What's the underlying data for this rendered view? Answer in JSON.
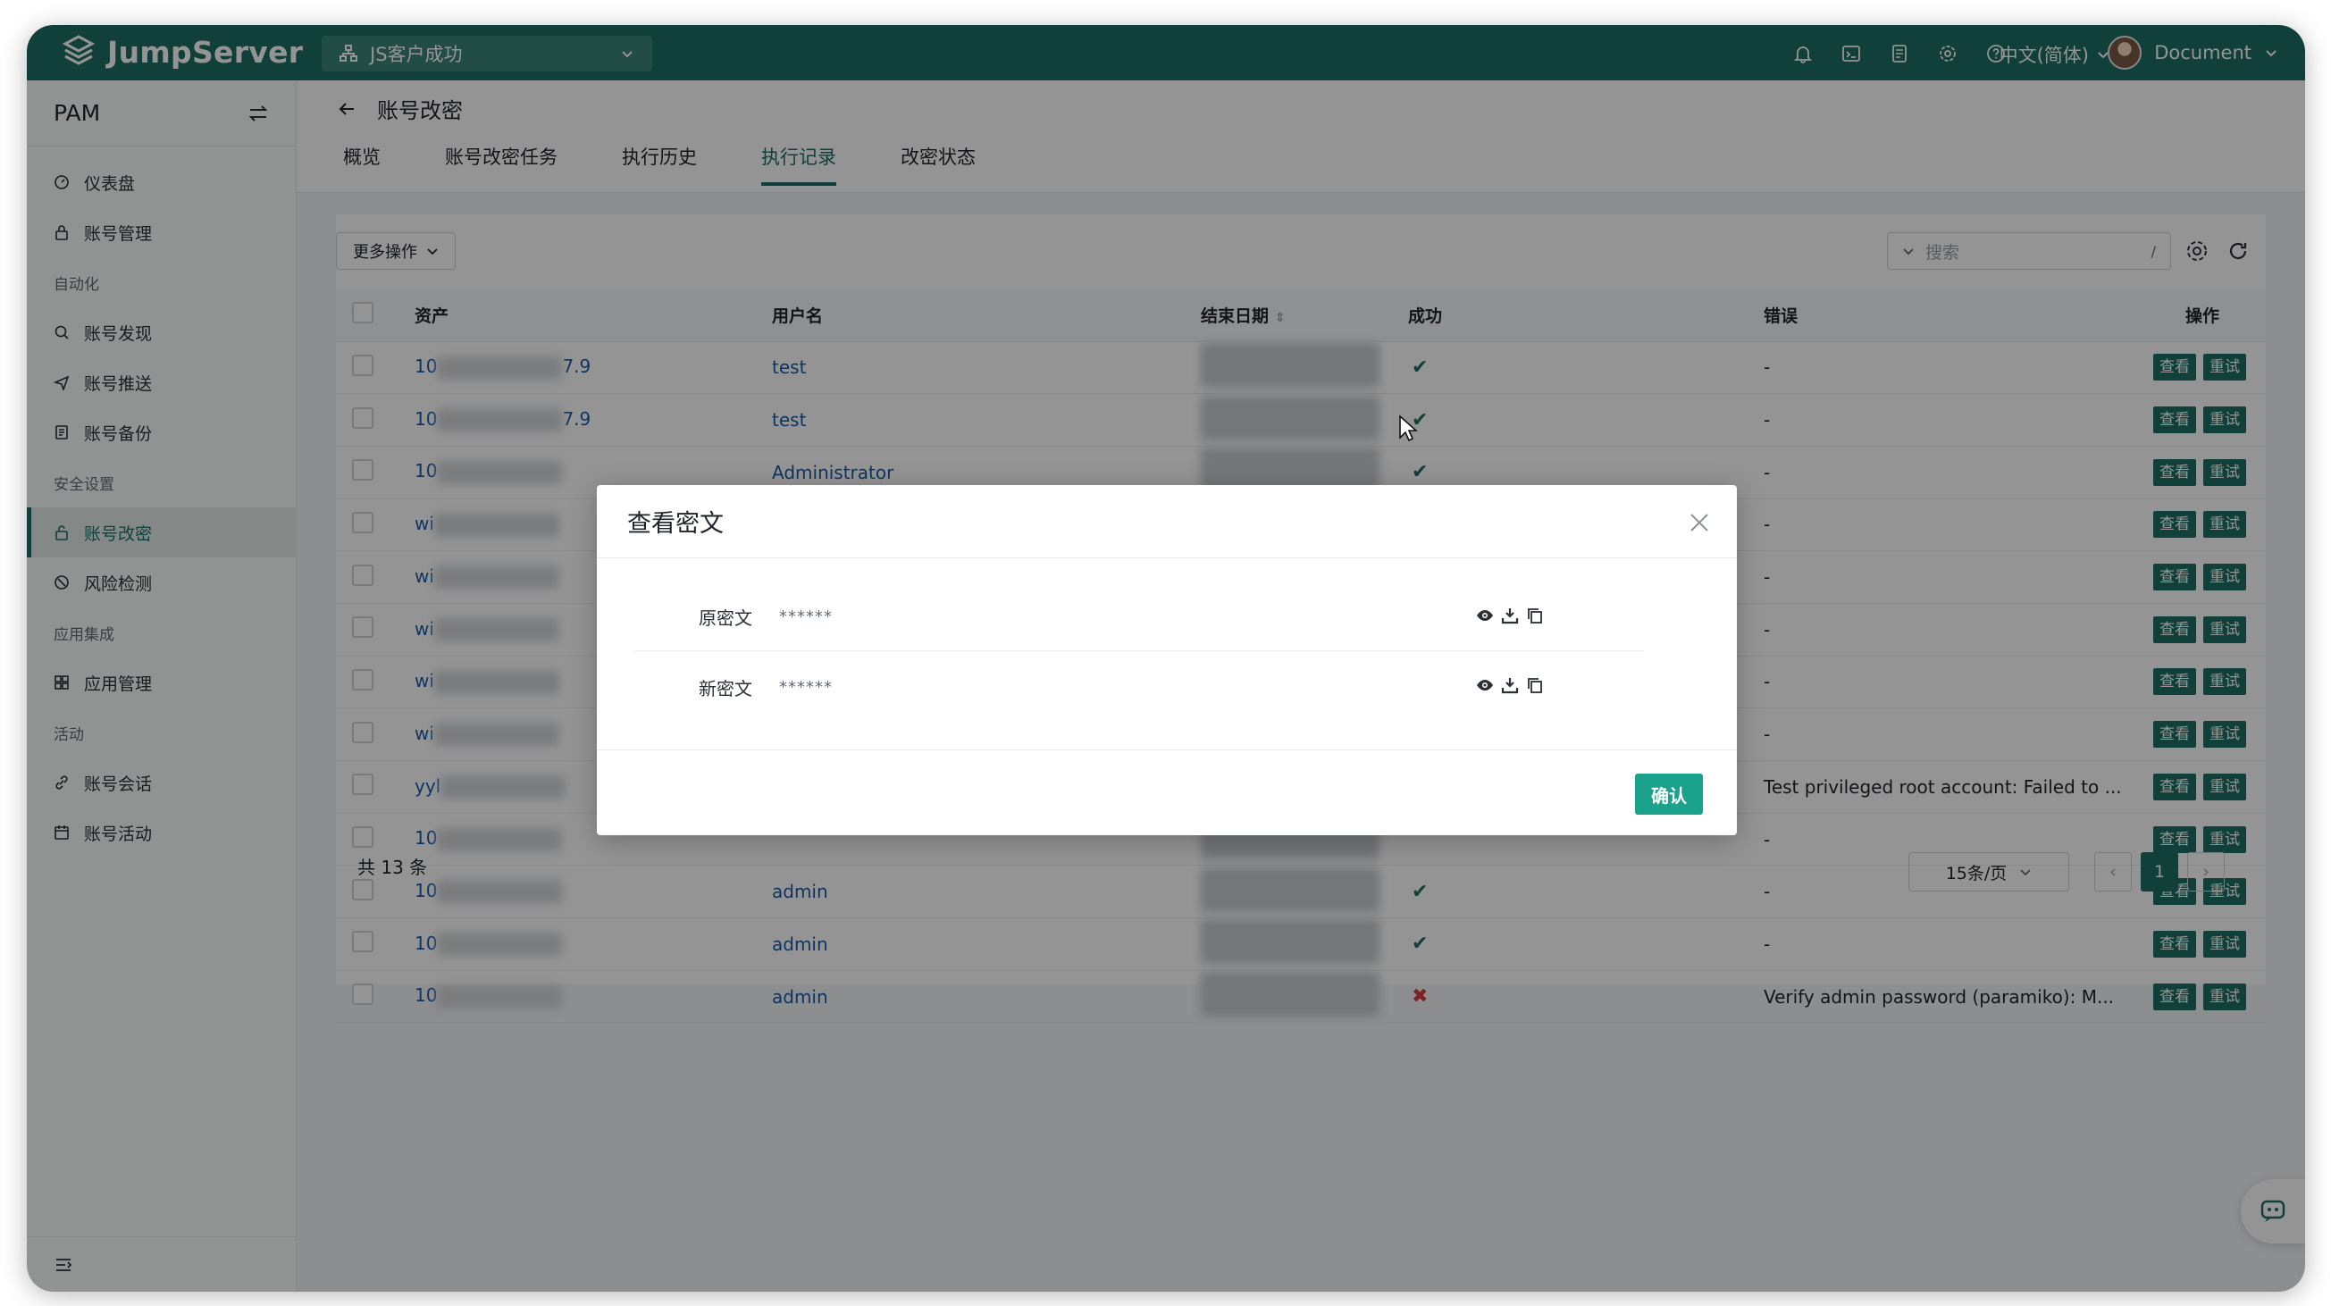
{
  "app": {
    "name": "JumpServer",
    "org": "JS客户成功",
    "language": "中文(简体)",
    "user": "Document"
  },
  "colors": {
    "brand": "#1c6f63",
    "confirm": "#1aa28c",
    "fail": "#d43d3d",
    "link": "#1a5aa8"
  },
  "topbar_icons": [
    "bell-icon",
    "terminal-icon",
    "notebook-icon",
    "gear-icon",
    "help-icon"
  ],
  "sidebar": {
    "title": "PAM",
    "items": [
      {
        "label": "仪表盘",
        "icon": "dashboard-icon"
      },
      {
        "label": "账号管理",
        "icon": "lock-icon"
      },
      {
        "group": "自动化"
      },
      {
        "label": "账号发现",
        "icon": "search-icon"
      },
      {
        "label": "账号推送",
        "icon": "send-icon"
      },
      {
        "label": "账号备份",
        "icon": "backup-icon"
      },
      {
        "group": "安全设置"
      },
      {
        "label": "账号改密",
        "icon": "key-lock-icon",
        "active": true
      },
      {
        "label": "风险检测",
        "icon": "risk-icon"
      },
      {
        "group": "应用集成"
      },
      {
        "label": "应用管理",
        "icon": "apps-icon"
      },
      {
        "group": "活动"
      },
      {
        "label": "账号会话",
        "icon": "link-icon"
      },
      {
        "label": "账号活动",
        "icon": "calendar-icon"
      }
    ]
  },
  "page": {
    "title": "账号改密",
    "tabs": [
      "概览",
      "账号改密任务",
      "执行历史",
      "执行记录",
      "改密状态"
    ],
    "active_tab": 3
  },
  "toolbar": {
    "more_actions": "更多操作",
    "search_placeholder": "搜索",
    "search_shortcut": "/"
  },
  "table": {
    "headers": {
      "asset": "资产",
      "username": "用户名",
      "end_date": "结束日期",
      "success": "成功",
      "error": "错误",
      "actions": "操作"
    },
    "view_label": "查看",
    "retry_label": "重试",
    "rows": [
      {
        "asset_prefix": "10",
        "asset_suffix": "7.9",
        "username": "test",
        "success": true,
        "error": "-"
      },
      {
        "asset_prefix": "10",
        "asset_suffix": "7.9",
        "username": "test",
        "success": true,
        "error": "-"
      },
      {
        "asset_prefix": "10",
        "asset_suffix": "",
        "username": "Administrator",
        "success": true,
        "error": "-"
      },
      {
        "asset_prefix": "wi",
        "asset_suffix": "",
        "username": "",
        "success": null,
        "error": "-"
      },
      {
        "asset_prefix": "wi",
        "asset_suffix": "",
        "username": "",
        "success": null,
        "error": "-"
      },
      {
        "asset_prefix": "wi",
        "asset_suffix": "",
        "username": "",
        "success": null,
        "error": "-"
      },
      {
        "asset_prefix": "wi",
        "asset_suffix": "",
        "username": "",
        "success": null,
        "error": "-"
      },
      {
        "asset_prefix": "wi",
        "asset_suffix": "",
        "username": "",
        "success": null,
        "error": "-"
      },
      {
        "asset_prefix": "yyl",
        "asset_suffix": "",
        "username": "",
        "success": null,
        "error": "Test privileged root account: Failed to ..."
      },
      {
        "asset_prefix": "10",
        "asset_suffix": "",
        "username": "",
        "success": null,
        "error": "-"
      },
      {
        "asset_prefix": "10",
        "asset_suffix": "",
        "username": "admin",
        "success": true,
        "error": "-"
      },
      {
        "asset_prefix": "10",
        "asset_suffix": "",
        "username": "admin",
        "success": true,
        "error": "-"
      },
      {
        "asset_prefix": "10",
        "asset_suffix": "",
        "username": "admin",
        "success": false,
        "error": "Verify admin password (paramiko): M..."
      }
    ]
  },
  "pagination": {
    "total": "共 13 条",
    "page_size": "15条/页",
    "current_page": "1"
  },
  "modal": {
    "title": "查看密文",
    "rows": [
      {
        "label": "原密文",
        "value": "******"
      },
      {
        "label": "新密文",
        "value": "******"
      }
    ],
    "confirm": "确认"
  }
}
